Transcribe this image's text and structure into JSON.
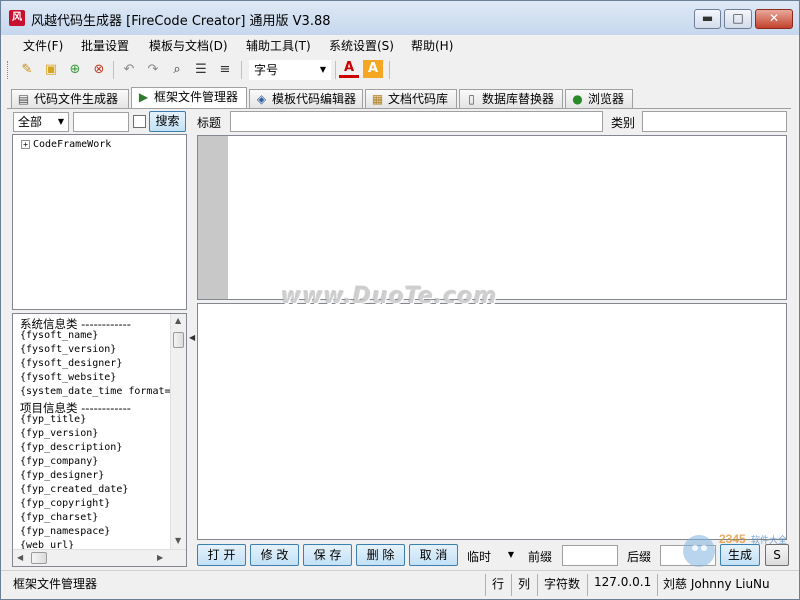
{
  "window": {
    "title": "风越代码生成器 [FireCode Creator] 通用版 V3.88",
    "app_icon_text": "风",
    "minimize_glyph": "▬",
    "maximize_glyph": "□",
    "close_glyph": "✕"
  },
  "menu": [
    "文件(F)",
    "批量设置",
    "模板与文档(D)",
    "辅助工具(T)",
    "系统设置(S)",
    "帮助(H)"
  ],
  "toolbar": {
    "icons": [
      "edit-icon",
      "new-folder-icon",
      "add-icon",
      "delete-icon",
      "undo-icon",
      "redo-icon",
      "search-icon",
      "list-icon",
      "numbered-list-icon",
      "font-color-icon",
      "highlight-icon"
    ],
    "font_size_label": "字号"
  },
  "tabs": [
    {
      "label": "代码文件生成器",
      "icon": "document-icon"
    },
    {
      "label": "框架文件管理器",
      "icon": "play-doc-icon"
    },
    {
      "label": "模板代码编辑器",
      "icon": "template-icon"
    },
    {
      "label": "文档代码库",
      "icon": "library-icon"
    },
    {
      "label": "数据库替换器",
      "icon": "book-icon"
    },
    {
      "label": "浏览器",
      "icon": "globe-icon"
    }
  ],
  "left": {
    "category_value": "全部",
    "search_button": "搜索",
    "tree_root": "CodeFrameWork",
    "variables": [
      {
        "text": "系统信息类 ------------",
        "section": true
      },
      {
        "text": "{fysoft_name}"
      },
      {
        "text": "{fysoft_version}"
      },
      {
        "text": "{fysoft_designer}"
      },
      {
        "text": "{fysoft_website}"
      },
      {
        "text": "{system_date_time format="
      },
      {
        "text": "项目信息类 ------------",
        "section": true
      },
      {
        "text": "{fyp_title}"
      },
      {
        "text": "{fyp_version}"
      },
      {
        "text": "{fyp_description}"
      },
      {
        "text": "{fyp_company}"
      },
      {
        "text": "{fyp_designer}"
      },
      {
        "text": "{fyp_created_date}"
      },
      {
        "text": "{fyp_copyright}"
      },
      {
        "text": "{fyp_charset}"
      },
      {
        "text": "{fyp_namespace}"
      },
      {
        "text": "{web_url}"
      }
    ]
  },
  "right": {
    "title_label": "标题",
    "category_label": "类别",
    "buttons": [
      "打 开",
      "修 改",
      "保 存",
      "删 除",
      "取 消"
    ],
    "temp_label": "临时",
    "prefix_label": "前缀",
    "suffix_label": "后缀",
    "generate_button": "生成",
    "truncated_button": "S"
  },
  "watermark": "www.DuoTe.com",
  "site_mark": "2345软件大全 国内最安全的软件站",
  "status": {
    "text": "框架文件管理器",
    "row": "行",
    "col": "列",
    "chars": "字符数",
    "ip": "127.0.0.1",
    "user": "刘慈 Johnny LiuNu"
  },
  "colors": {
    "titlebar": "#c6d7ee",
    "close_button": "#c2412c",
    "gutter": "#c8c8c8",
    "blue_button": "#c3e1f7"
  }
}
